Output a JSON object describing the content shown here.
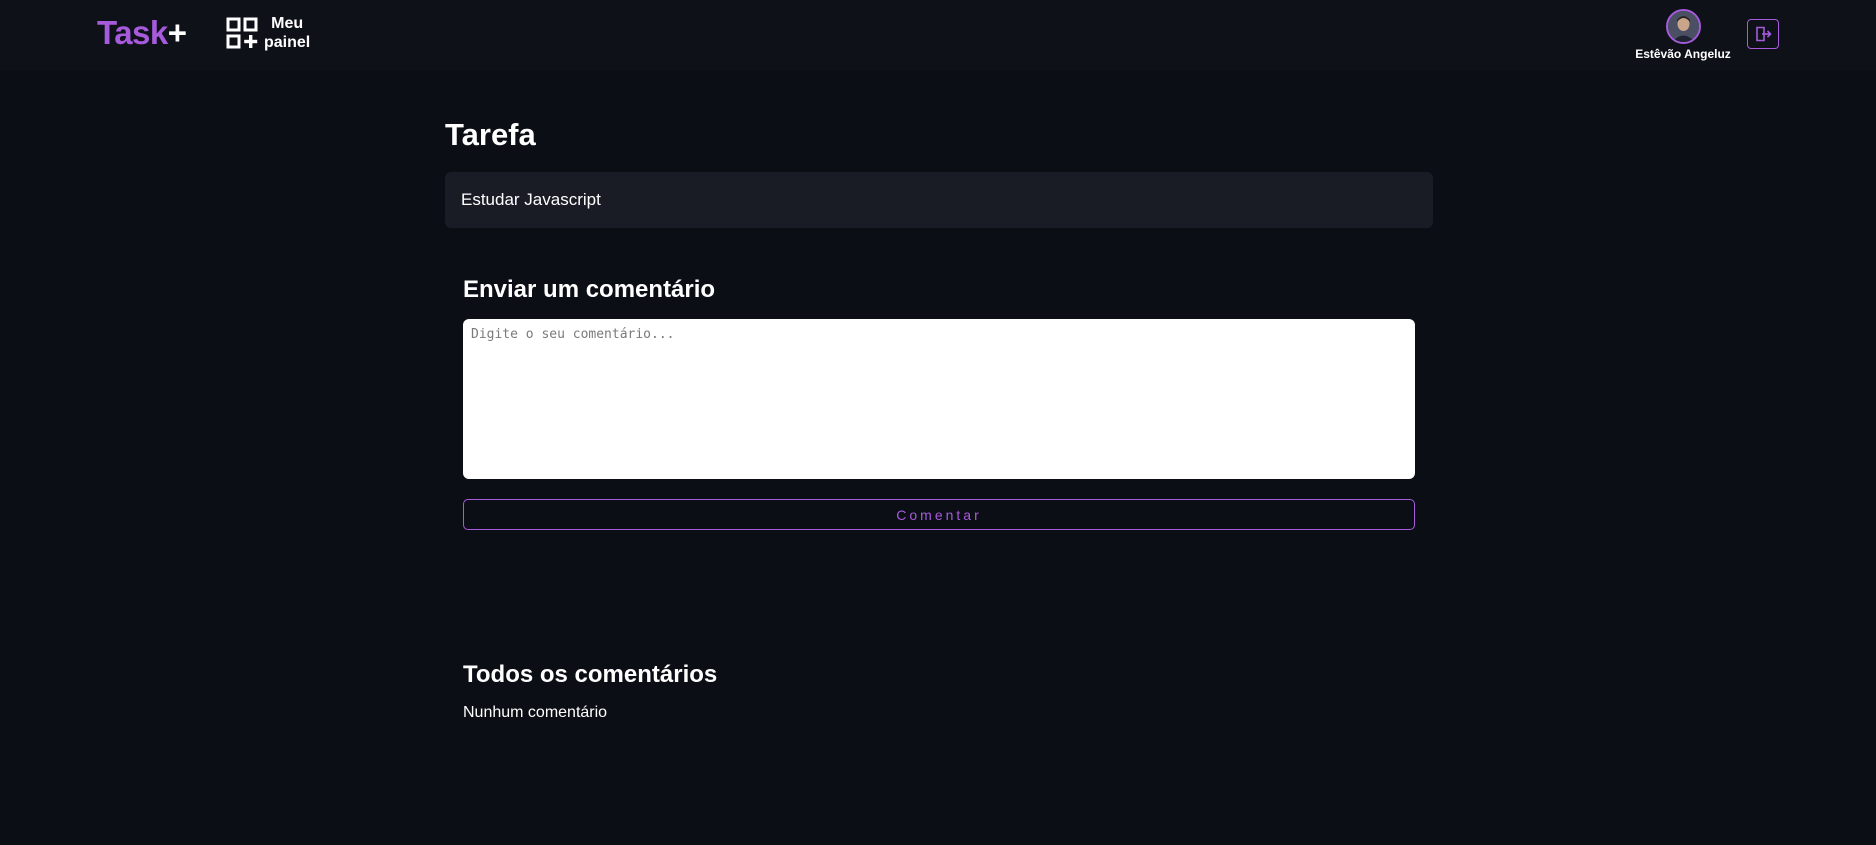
{
  "header": {
    "logo_main": "Task",
    "logo_plus": "+",
    "panel_label_line1": "Meu",
    "panel_label_line2": "painel",
    "panel_icon": "grid-plus-icon",
    "user_name": "Estêvão Angeluz",
    "logout_icon": "logout-icon"
  },
  "main": {
    "title": "Tarefa",
    "task_text": "Estudar Javascript",
    "comment_heading": "Enviar um comentário",
    "comment_placeholder": "Digite o seu comentário...",
    "comment_value": "",
    "comment_button": "Comentar",
    "all_comments_heading": "Todos os comentários",
    "empty_comments": "Nunhum comentário"
  },
  "colors": {
    "background": "#0c0e15",
    "header_background": "#0f1118",
    "accent": "#a55bdc",
    "task_box": "#1a1c25"
  }
}
